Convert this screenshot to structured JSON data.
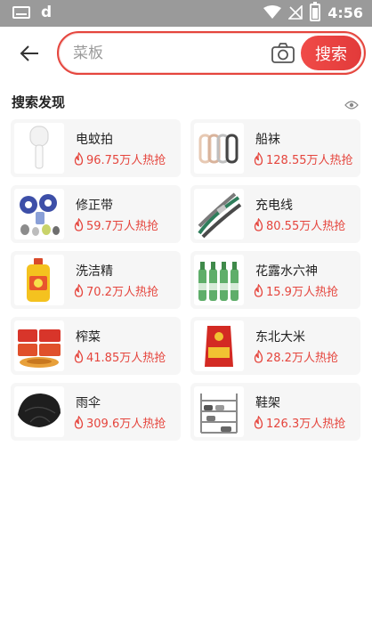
{
  "status_bar": {
    "time": "4:56",
    "left_glyph": "d"
  },
  "search": {
    "placeholder": "菜板",
    "button_label": "搜索"
  },
  "discover": {
    "title": "搜索发现"
  },
  "items": [
    {
      "title": "电蚊拍",
      "hot": "96.75万人热抢"
    },
    {
      "title": "船袜",
      "hot": "128.55万人热抢"
    },
    {
      "title": "修正带",
      "hot": "59.7万人热抢"
    },
    {
      "title": "充电线",
      "hot": "80.55万人热抢"
    },
    {
      "title": "洗洁精",
      "hot": "70.2万人热抢"
    },
    {
      "title": "花露水六神",
      "hot": "15.9万人热抢"
    },
    {
      "title": "榨菜",
      "hot": "41.85万人热抢"
    },
    {
      "title": "东北大米",
      "hot": "28.2万人热抢"
    },
    {
      "title": "雨伞",
      "hot": "309.6万人热抢"
    },
    {
      "title": "鞋架",
      "hot": "126.3万人热抢"
    }
  ],
  "colors": {
    "accent": "#e5453d",
    "card_bg": "#f6f6f6",
    "status_bar": "#9a9a9a"
  },
  "icons": {
    "back": "arrow-left-icon",
    "camera": "camera-icon",
    "eye": "eye-icon",
    "hot": "flame-icon"
  }
}
